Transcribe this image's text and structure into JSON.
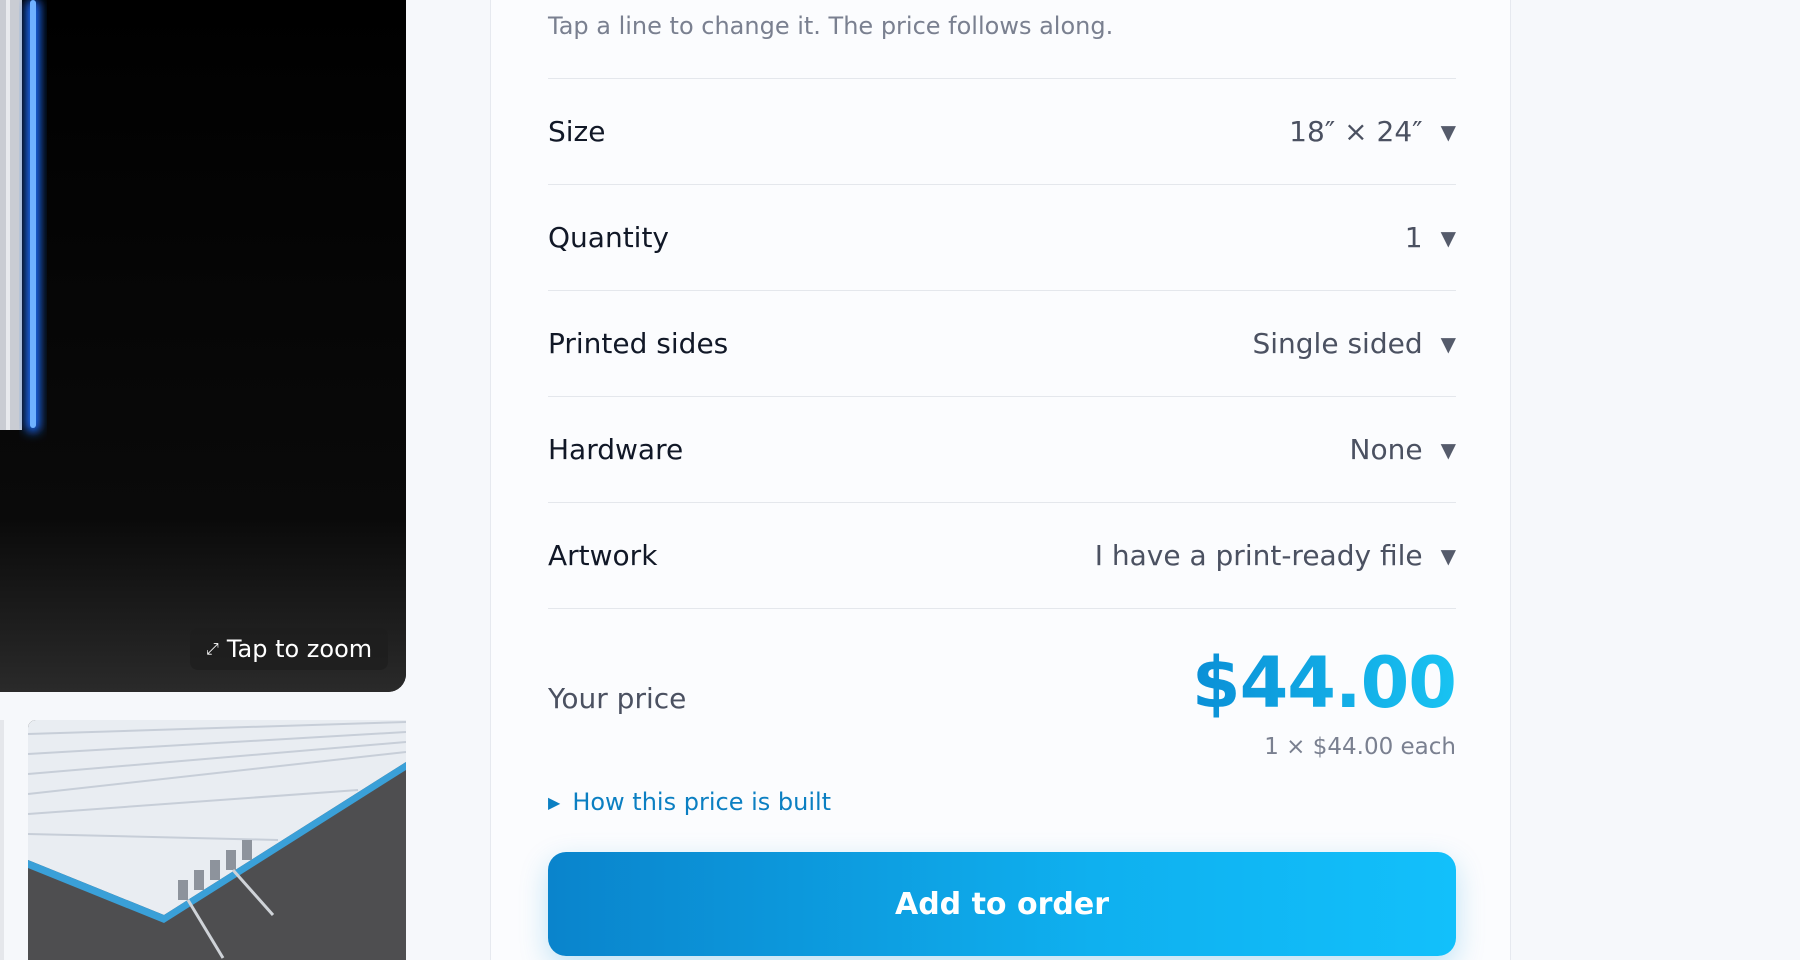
{
  "gallery": {
    "zoom_label": "Tap to zoom",
    "zoom_icon": "expand-arrows-icon"
  },
  "configurator": {
    "hint": "Tap a line to change it. The price follows along.",
    "options": [
      {
        "label": "Size",
        "value": "18″ × 24″"
      },
      {
        "label": "Quantity",
        "value": "1"
      },
      {
        "label": "Printed sides",
        "value": "Single sided"
      },
      {
        "label": "Hardware",
        "value": "None"
      },
      {
        "label": "Artwork",
        "value": "I have a print-ready file"
      }
    ],
    "caret": "▼"
  },
  "price": {
    "label": "Your price",
    "total": "$44.00",
    "each": "1 × $44.00 each",
    "breakdown_label": "How this price is built",
    "accent_start": "#0a8fd6",
    "accent_end": "#19c3f2"
  },
  "actions": {
    "add_to_order": "Add to order"
  }
}
